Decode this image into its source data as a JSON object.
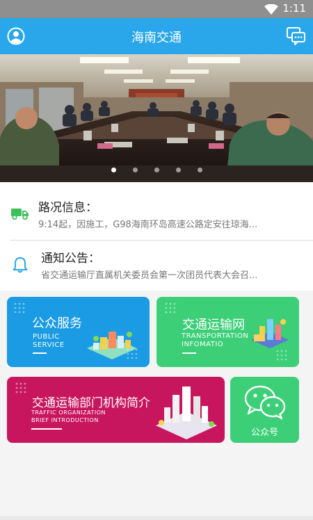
{
  "status_bar": {
    "time": "1:11"
  },
  "header": {
    "title": "海南交通"
  },
  "banner": {
    "dot_count": 5,
    "active_index": 0
  },
  "road_info": {
    "label": "路况信息：",
    "text": "9:14起，因施工，G98海南环岛高速公路定安往琼海..."
  },
  "notice": {
    "label": "通知公告：",
    "text": "省交通运输厅直属机关委员会第一次团员代表大会召..."
  },
  "tiles": {
    "public_service": {
      "title": "公众服务",
      "subtitle_1": "PUBLIC",
      "subtitle_2": "SERVICE",
      "color": "#1a9be4"
    },
    "transport_net": {
      "title": "交通运输网",
      "subtitle_1": "TRANSPORTATION",
      "subtitle_2": "INFOMATIO",
      "color": "#3ccf78"
    },
    "org_intro": {
      "title": "交通运输部门机构简介",
      "subtitle_1": "TRAFFIC ORGANIZATION",
      "subtitle_2": "BRIEF INTRODUCTION",
      "color": "#c8165e"
    },
    "wechat": {
      "title": "公众号",
      "color": "#3ccf78"
    }
  },
  "colors": {
    "primary": "#29a7ea",
    "truck_icon": "#3cc05a",
    "bell_icon": "#29a7ea"
  }
}
